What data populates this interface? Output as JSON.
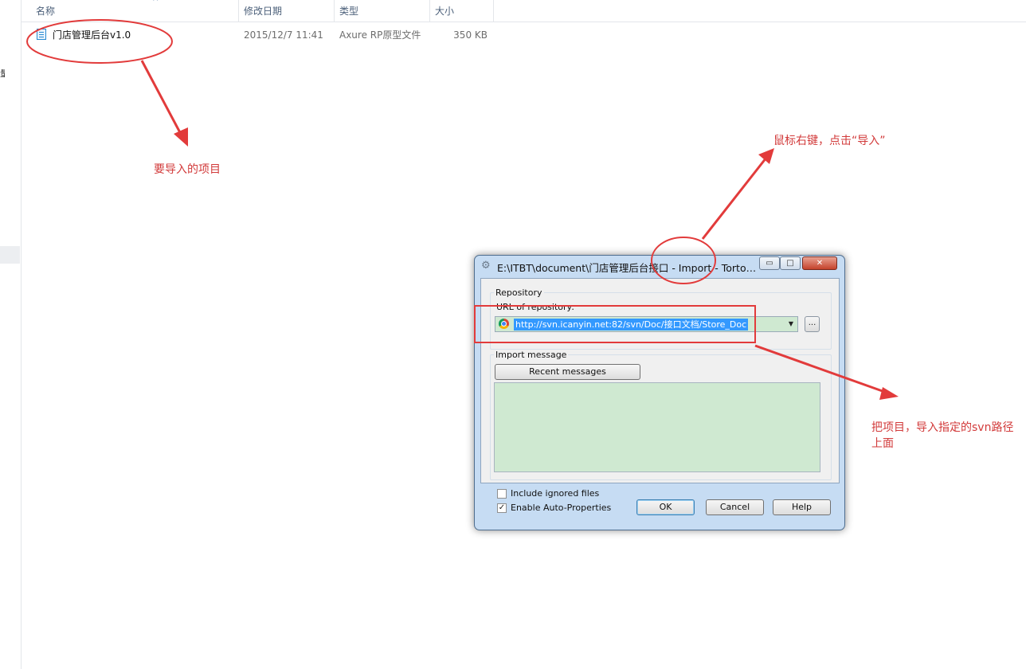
{
  "left_pane": {
    "fragment": "量"
  },
  "explorer": {
    "columns": [
      "名称",
      "修改日期",
      "类型",
      "大小"
    ],
    "sort_indicator": "^",
    "files": [
      {
        "name": "门店管理后台v1.0",
        "modified": "2015/12/7 11:41",
        "type": "Axure RP原型文件",
        "size": "350 KB"
      }
    ]
  },
  "annotations": {
    "project_label": "要导入的项目",
    "right_click_label": "鼠标右键，点击“导入”",
    "import_path_label": "把项目，导入指定的svn路径上面"
  },
  "dialog": {
    "title": "E:\\ITBT\\document\\门店管理后台接口 - Import - TortoiseSVN",
    "title_icon": "tortoisesvn-icon",
    "minimize_glyph": "▭",
    "maximize_glyph": "□",
    "close_glyph": "✕",
    "repository_label": "Repository",
    "url_label": "URL of repository:",
    "url_value": "http://svn.icanyin.net:82/svn/Doc/接口文档/Store_Doc",
    "combo_arrow": "▼",
    "browse_label": "...",
    "import_message_label": "Import message",
    "recent_messages_label": "Recent messages",
    "include_ignored_label": "Include ignored files",
    "include_ignored_checked": false,
    "auto_props_label": "Enable Auto-Properties",
    "auto_props_checked": true,
    "check_glyph": "✓",
    "ok_label": "OK",
    "cancel_label": "Cancel",
    "help_label": "Help"
  },
  "colors": {
    "annotation_red": "#d23a3a",
    "selection_blue": "#3399ff",
    "field_green": "#cfe9d1",
    "dialog_frame": "#c6dcf3"
  }
}
